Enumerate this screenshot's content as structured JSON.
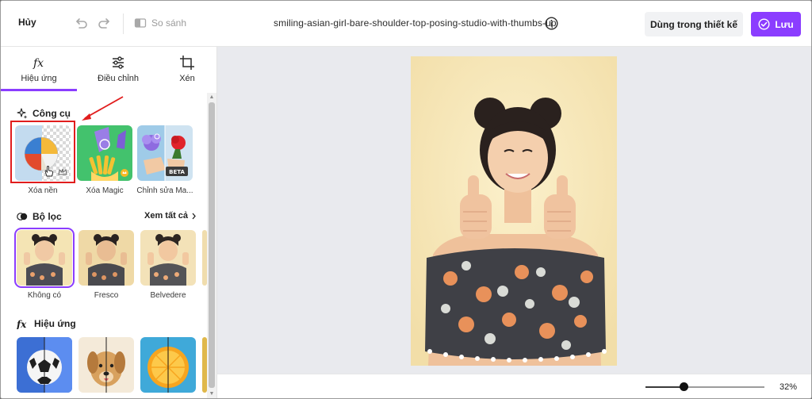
{
  "topbar": {
    "cancel_label": "Hủy",
    "compare_label": "So sánh",
    "filename": "smiling-asian-girl-bare-shoulder-top-posing-studio-with-thumbs-up",
    "use_in_design_label": "Dùng trong thiết kế",
    "save_label": "Lưu"
  },
  "tabs": [
    {
      "label": "Hiệu ứng",
      "icon": "fx-icon",
      "active": true
    },
    {
      "label": "Điều chỉnh",
      "icon": "sliders-icon",
      "active": false
    },
    {
      "label": "Xén",
      "icon": "crop-icon",
      "active": false
    }
  ],
  "tools": {
    "title": "Công cụ",
    "items": [
      {
        "label": "Xóa nền"
      },
      {
        "label": "Xóa Magic"
      },
      {
        "label": "Chỉnh sửa Ma..."
      }
    ],
    "beta_badge": "BETA"
  },
  "filters": {
    "title": "Bộ lọc",
    "see_all_label": "Xem tất cả",
    "items": [
      {
        "label": "Không có",
        "selected": true
      },
      {
        "label": "Fresco",
        "selected": false
      },
      {
        "label": "Belvedere",
        "selected": false
      }
    ]
  },
  "effects": {
    "title": "Hiệu ứng"
  },
  "zoom": {
    "level": 0.32,
    "label": "32%"
  },
  "colors": {
    "accent": "#8b3dff",
    "highlight": "#e11d1d"
  }
}
